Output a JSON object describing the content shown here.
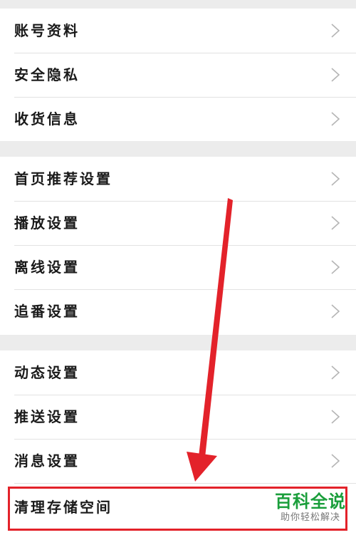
{
  "groups": [
    {
      "items": [
        {
          "label": "账号资料"
        },
        {
          "label": "安全隐私"
        },
        {
          "label": "收货信息"
        }
      ]
    },
    {
      "items": [
        {
          "label": "首页推荐设置"
        },
        {
          "label": "播放设置"
        },
        {
          "label": "离线设置"
        },
        {
          "label": "追番设置"
        }
      ]
    },
    {
      "items": [
        {
          "label": "动态设置"
        },
        {
          "label": "推送设置"
        },
        {
          "label": "消息设置"
        },
        {
          "label": "清理存储空间"
        }
      ]
    }
  ],
  "annotation": {
    "color": "#e3222a"
  },
  "watermark": {
    "main": "百科全说",
    "sub": "助你轻松解决",
    "color": "#1a9e3b"
  }
}
